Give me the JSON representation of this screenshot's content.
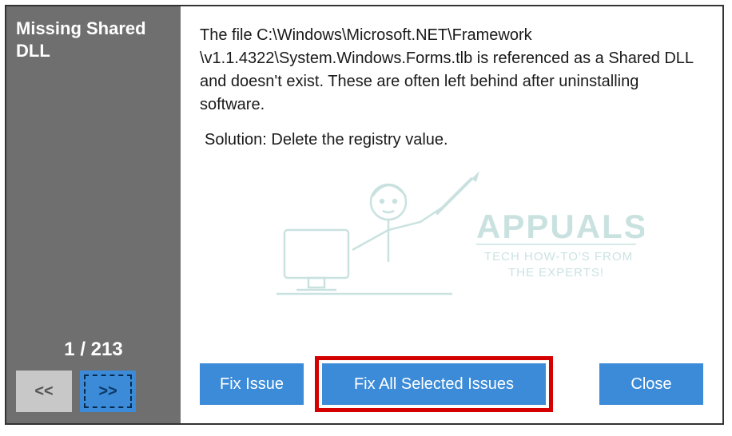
{
  "sidebar": {
    "title": "Missing Shared DLL",
    "counter": "1 / 213",
    "prev_label": "<<",
    "next_label": ">>"
  },
  "main": {
    "description": "The file C:\\Windows\\Microsoft.NET\\Framework \\v1.1.4322\\System.Windows.Forms.tlb is referenced as a Shared DLL and doesn't exist. These are often left behind after uninstalling software.",
    "solution": "Solution: Delete the registry value."
  },
  "buttons": {
    "fix_issue": "Fix Issue",
    "fix_all": "Fix All Selected Issues",
    "close": "Close"
  },
  "watermark": {
    "brand": "APPUALS",
    "tagline": "TECH HOW-TO'S FROM THE EXPERTS!"
  }
}
